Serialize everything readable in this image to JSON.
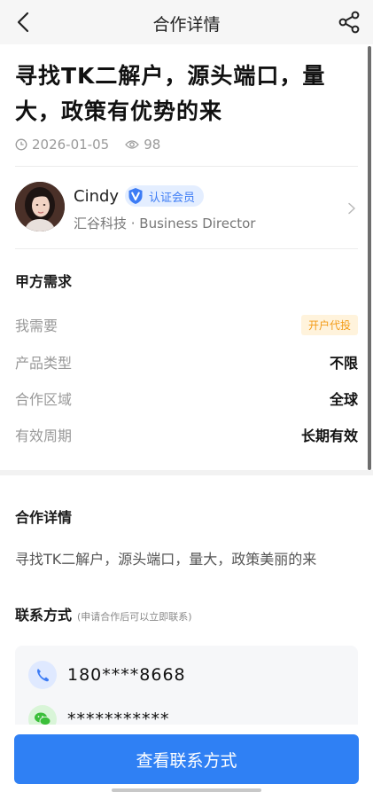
{
  "header": {
    "title": "合作详情",
    "back_icon": "back-arrow-icon",
    "share_icon": "share-icon"
  },
  "post": {
    "title": "寻找TK二解户，源头端口，量大，政策有优势的来",
    "date": "2026-01-05",
    "views": "98"
  },
  "author": {
    "name": "Cindy",
    "badge": "认证会员",
    "company_line": "汇谷科技 · Business Director"
  },
  "requirements": {
    "heading": "甲方需求",
    "rows": [
      {
        "key": "我需要",
        "value": "开户代投"
      },
      {
        "key": "产品类型",
        "value": "不限"
      },
      {
        "key": "合作区域",
        "value": "全球"
      },
      {
        "key": "有效周期",
        "value": "长期有效"
      }
    ]
  },
  "details": {
    "heading": "合作详情",
    "text": "寻找TK二解户，源头端口，量大，政策美丽的来"
  },
  "contact": {
    "heading": "联系方式",
    "subheading": "(申请合作后可以立即联系)",
    "phone": "180****8668",
    "wechat": "***********"
  },
  "cta": {
    "label": "查看联系方式"
  },
  "colors": {
    "accent": "#2f80f4",
    "badge_text": "#3d7cf5",
    "tag_orange": "#f39b16",
    "wechat_green": "#3bbf3a"
  }
}
